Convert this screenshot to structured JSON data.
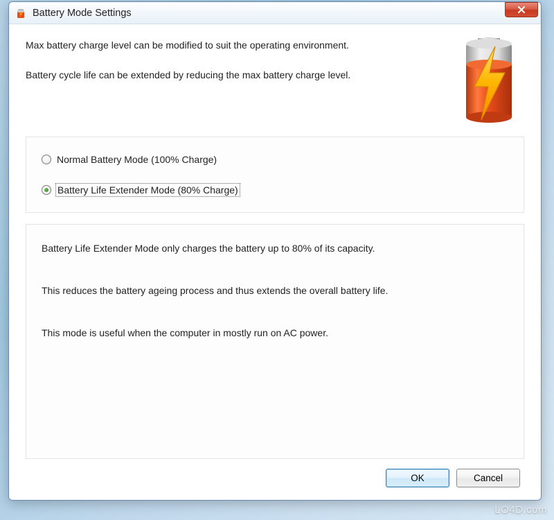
{
  "window": {
    "title": "Battery Mode Settings"
  },
  "intro": {
    "line1": "Max battery charge level can be modified to suit the operating environment.",
    "line2": "Battery cycle life can be extended by reducing the max battery charge level."
  },
  "options": {
    "normal": {
      "label": "Normal Battery Mode (100% Charge)",
      "checked": false
    },
    "extender": {
      "label": "Battery Life Extender Mode (80% Charge)",
      "checked": true
    }
  },
  "description": {
    "line1": "Battery Life Extender Mode only charges the battery up to 80% of its capacity.",
    "line2": "This reduces the battery ageing process and thus extends the overall battery life.",
    "line3": "This mode is useful when the computer in mostly run on AC power."
  },
  "buttons": {
    "ok": "OK",
    "cancel": "Cancel"
  },
  "watermark": "LO4D.com",
  "colors": {
    "battery_body": "#e84c1a",
    "battery_top": "#b8b8b8",
    "bolt": "#ffb400",
    "close_red": "#d6563e"
  }
}
